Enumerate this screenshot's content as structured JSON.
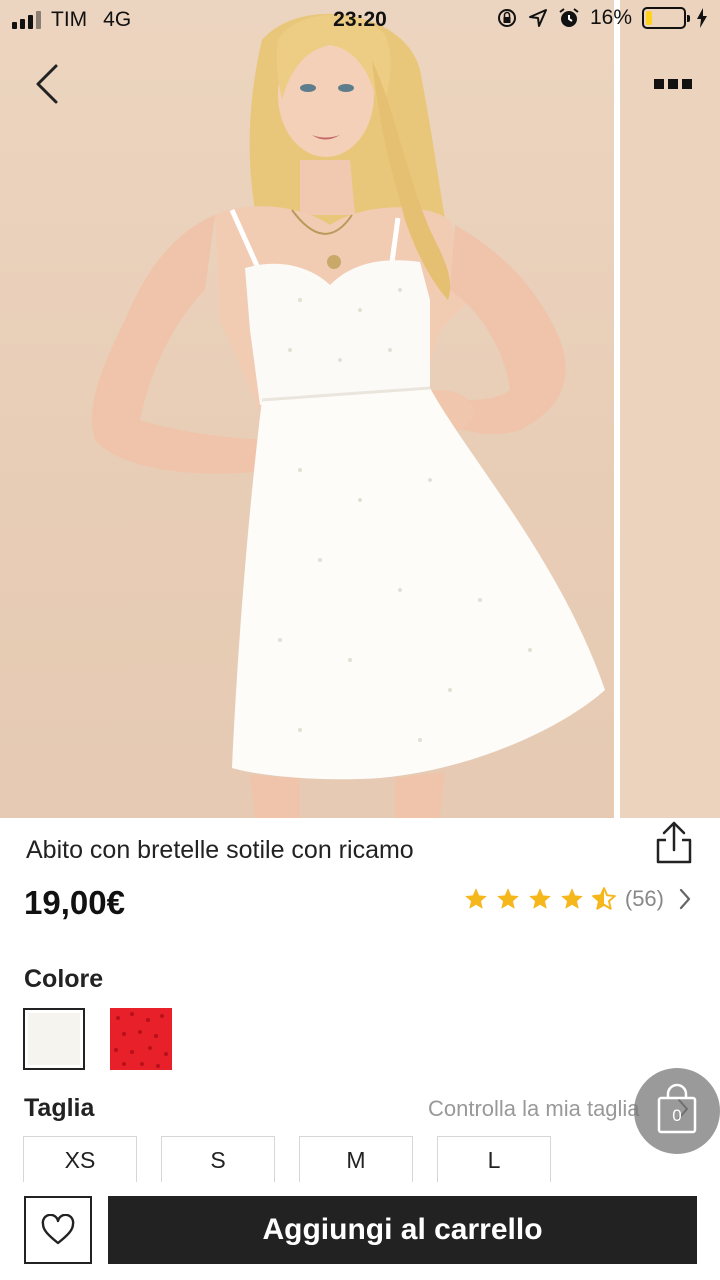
{
  "status_bar": {
    "carrier": "TIM",
    "network": "4G",
    "time": "23:20",
    "battery": "16%",
    "battery_level": 0.16,
    "icons": [
      "lock-rotation-icon",
      "location-arrow-icon",
      "alarm-icon",
      "charging-bolt-icon"
    ]
  },
  "header": {
    "back_icon": "chevron-left-icon",
    "more_icon": "more-dots-icon"
  },
  "product": {
    "title": "Abito con bretelle sotile con ricamo",
    "price": "19,00€",
    "rating": 4.5,
    "review_count": "(56)",
    "share_icon": "share-icon"
  },
  "colors": {
    "label": "Colore",
    "options": [
      {
        "name": "white-swatch",
        "hex": "#f6f4ef",
        "selected": true
      },
      {
        "name": "red-swatch",
        "hex": "#e8202a",
        "selected": false
      }
    ]
  },
  "sizes": {
    "label": "Taglia",
    "guide_link": "Controlla la mia taglia",
    "options": [
      "XS",
      "S",
      "M",
      "L"
    ]
  },
  "cart": {
    "count": "0"
  },
  "actions": {
    "add_to_cart": "Aggiungi al carrello",
    "favorite_icon": "heart-icon"
  },
  "colors_theme": {
    "background": "#ffffff",
    "primary_button": "#222222",
    "star": "#f6b71c",
    "muted_text": "#888888"
  }
}
